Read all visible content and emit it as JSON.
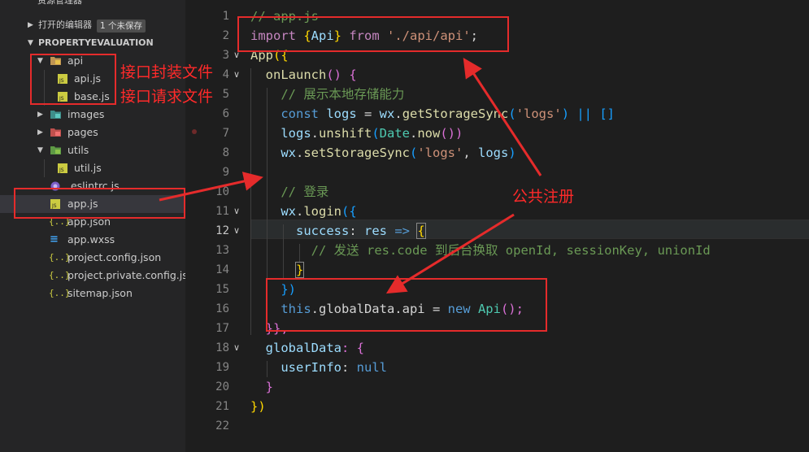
{
  "sidebar": {
    "title": "资源管理器",
    "more": "···",
    "open_editors": {
      "label": "打开的编辑器",
      "badge": "1 个未保存"
    },
    "project": {
      "label": "PROPERTYEVALUATION"
    },
    "tree": [
      {
        "name": "api",
        "kind": "folder",
        "expanded": true,
        "icon": "folder-api-icon"
      },
      {
        "name": "api.js",
        "kind": "js"
      },
      {
        "name": "base.js",
        "kind": "js"
      },
      {
        "name": "images",
        "kind": "folder",
        "expanded": false,
        "icon": "folder-images-icon"
      },
      {
        "name": "pages",
        "kind": "folder",
        "expanded": false,
        "icon": "folder-pages-icon"
      },
      {
        "name": "utils",
        "kind": "folder",
        "expanded": true,
        "icon": "folder-utils-icon"
      },
      {
        "name": "util.js",
        "kind": "js"
      },
      {
        "name": ".eslintrc.js",
        "kind": "eslint"
      },
      {
        "name": "app.js",
        "kind": "js",
        "active": true
      },
      {
        "name": "app.json",
        "kind": "json"
      },
      {
        "name": "app.wxss",
        "kind": "css"
      },
      {
        "name": "project.config.json",
        "kind": "json"
      },
      {
        "name": "project.private.config.js...",
        "kind": "json"
      },
      {
        "name": "sitemap.json",
        "kind": "json"
      }
    ]
  },
  "editor": {
    "file": "app.js",
    "current_line": 12,
    "line_numbers": [
      "1",
      "2",
      "3",
      "4",
      "5",
      "6",
      "7",
      "8",
      "9",
      "10",
      "11",
      "12",
      "13",
      "14",
      "15",
      "16",
      "17",
      "18",
      "19",
      "20",
      "21",
      "22"
    ],
    "code": {
      "l1": "// app.js",
      "l2_import": "import",
      "l2_a": " {",
      "l2_api": "Api",
      "l2_b": "} ",
      "l2_from": "from",
      "l2_str": "'./api/api'",
      "l2_c": ";",
      "l3_fn": "App",
      "l3_b": "({",
      "l4_fn": "onLaunch",
      "l4_b": "() {",
      "l5": "// 展示本地存储能力",
      "l6_const": "const",
      "l6_a": " logs ",
      "l6_b": "= ",
      "l6_wx": "wx",
      "l6_c": ".",
      "l6_fn": "getStorageSync",
      "l6_d": "(",
      "l6_str": "'logs'",
      "l6_e": ") || []",
      "l7_logs": "logs",
      "l7_a": ".",
      "l7_fn": "unshift",
      "l7_b": "(",
      "l7_date": "Date",
      "l7_c": ".",
      "l7_now": "now",
      "l7_d": "())",
      "l8_wx": "wx",
      "l8_a": ".",
      "l8_fn": "setStorageSync",
      "l8_b": "(",
      "l8_str": "'logs'",
      "l8_c": ", ",
      "l8_logs": "logs",
      "l8_d": ")",
      "l10": "// 登录",
      "l11_wx": "wx",
      "l11_a": ".",
      "l11_fn": "login",
      "l11_b": "({",
      "l12_prop": "success",
      "l12_a": ": ",
      "l12_res": "res",
      "l12_arrow": " => ",
      "l12_b": "{",
      "l13": "// 发送 res.code 到后台换取 openId, sessionKey, unionId",
      "l14": "}",
      "l15": "})",
      "l16_this": "this",
      "l16_a": ".globalData.api ",
      "l16_eq": "= ",
      "l16_new": "new ",
      "l16_cls": "Api",
      "l16_b": "();",
      "l17": "}},",
      "l18_prop": "globalData",
      "l18_a": ": {",
      "l19_prop": "userInfo",
      "l19_a": ": ",
      "l19_null": "null",
      "l20": "}",
      "l21": "})"
    }
  },
  "annotations": {
    "interface_wrapper": "接口封装文件",
    "interface_request": "接口请求文件",
    "public_register": "公共注册"
  },
  "colors": {
    "annotation": "#e52b2b",
    "editor_bg": "#1e1e1e",
    "sidebar_bg": "#252526"
  }
}
